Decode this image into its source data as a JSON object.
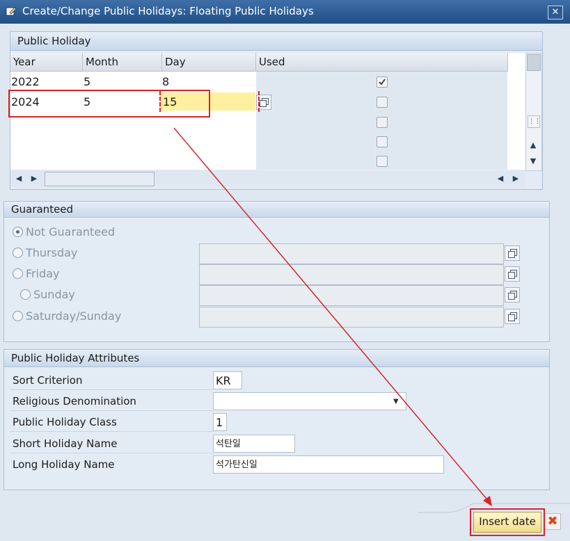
{
  "window": {
    "title": "Create/Change Public Holidays: Floating Public Holidays"
  },
  "public_holiday": {
    "section_title": "Public Holiday",
    "columns": [
      "Year",
      "Month",
      "Day",
      "Used"
    ],
    "rows": [
      {
        "year": "2022",
        "month": "5",
        "day": "8",
        "used": true
      },
      {
        "year": "2024",
        "month": "5",
        "day": "15",
        "used": false
      },
      {
        "year": "",
        "month": "",
        "day": "",
        "used": false
      },
      {
        "year": "",
        "month": "",
        "day": "",
        "used": false
      },
      {
        "year": "",
        "month": "",
        "day": "",
        "used": false
      }
    ]
  },
  "guaranteed": {
    "section_title": "Guaranteed",
    "options": [
      "Not Guaranteed",
      "Thursday",
      "Friday",
      "Sunday",
      "Saturday/Sunday"
    ],
    "selected": "Not Guaranteed"
  },
  "attributes": {
    "section_title": "Public Holiday Attributes",
    "sort_criterion": {
      "label": "Sort Criterion",
      "value": "KR"
    },
    "religious_denomination": {
      "label": "Religious Denomination",
      "value": ""
    },
    "holiday_class": {
      "label": "Public Holiday Class",
      "value": "1"
    },
    "short_name": {
      "label": "Short Holiday Name",
      "value": "석탄일"
    },
    "long_name": {
      "label": "Long Holiday Name",
      "value": "석가탄신일"
    }
  },
  "footer": {
    "insert_label": "Insert date"
  },
  "colors": {
    "highlight": "#d8232a",
    "active_cell": "#fff0a0",
    "button_yellow": "#f3dc86"
  }
}
